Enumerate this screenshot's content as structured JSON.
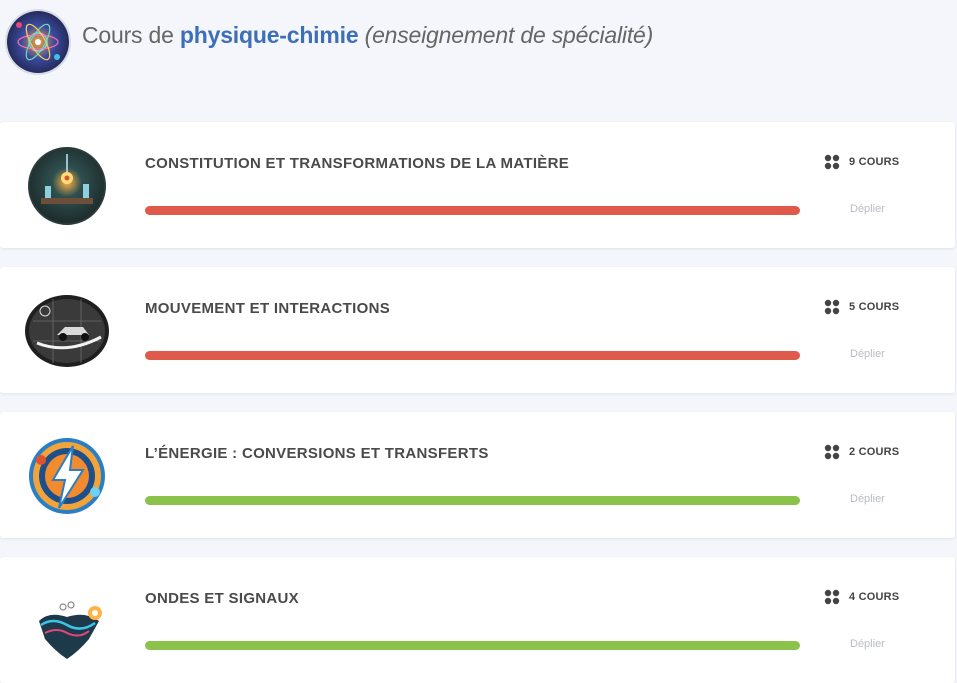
{
  "header": {
    "title_prefix": "Cours de ",
    "title_accent": "physique-chimie",
    "title_suffix": " (enseignement de spécialité)",
    "logo_icon": "physics-chemistry-logo-icon"
  },
  "colors": {
    "accent": "#3d6fb8",
    "progress_red": "#e05a4c",
    "progress_green": "#8bc34a",
    "muted": "#b9bcc4"
  },
  "cards": [
    {
      "title": "CONSTITUTION ET TRANSFORMATIONS DE LA MATIÈRE",
      "count_label": "9 COURS",
      "expand_label": "Déplier",
      "progress_color": "#e05a4c",
      "progress": 1.0,
      "icon": "matter-lab-icon"
    },
    {
      "title": "MOUVEMENT ET INTERACTIONS",
      "count_label": "5 COURS",
      "expand_label": "Déplier",
      "progress_color": "#e05a4c",
      "progress": 1.0,
      "icon": "moving-car-icon"
    },
    {
      "title": "L’ÉNERGIE : CONVERSIONS ET TRANSFERTS",
      "count_label": "2 COURS",
      "expand_label": "Déplier",
      "progress_color": "#8bc34a",
      "progress": 1.0,
      "icon": "lightning-energy-icon"
    },
    {
      "title": "ONDES ET SIGNAUX",
      "count_label": "4 COURS",
      "expand_label": "Déplier",
      "progress_color": "#8bc34a",
      "progress": 1.0,
      "icon": "waves-signals-icon"
    }
  ]
}
